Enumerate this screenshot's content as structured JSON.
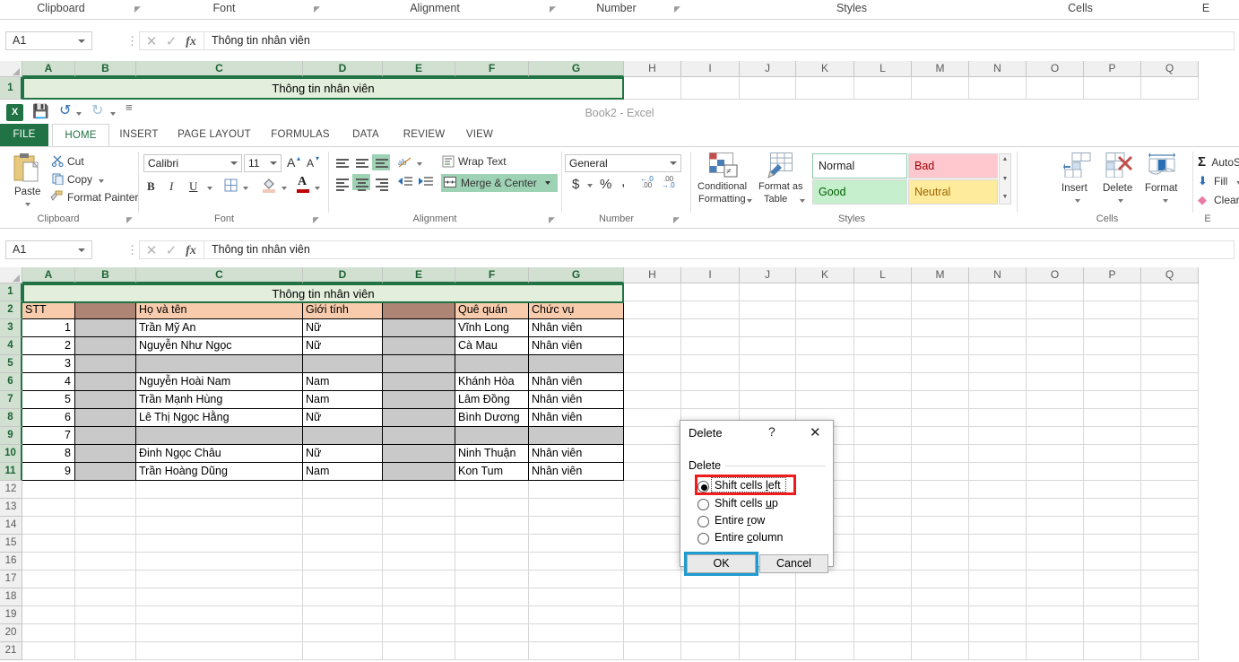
{
  "top_strip": {
    "group_labels": [
      "Clipboard",
      "Font",
      "Alignment",
      "Number",
      "Styles",
      "Cells",
      "E"
    ],
    "name_box": "A1",
    "formula_value": "Thông tin nhân viên",
    "cancel_icon": "cancel-icon",
    "enter_icon": "enter-icon",
    "fx_icon": "fx-icon"
  },
  "window": {
    "title": "Book2 - Excel",
    "logo_text": "X",
    "qat": [
      {
        "name": "save-icon",
        "glyph": "💾"
      },
      {
        "name": "undo-icon",
        "glyph": "↶"
      },
      {
        "name": "redo-icon",
        "glyph": "↷"
      },
      {
        "name": "customize-qat-icon",
        "glyph": "≡"
      }
    ],
    "tabs": [
      {
        "label": "FILE",
        "active": false
      },
      {
        "label": "HOME",
        "active": true
      },
      {
        "label": "INSERT",
        "active": false
      },
      {
        "label": "PAGE LAYOUT",
        "active": false
      },
      {
        "label": "FORMULAS",
        "active": false
      },
      {
        "label": "DATA",
        "active": false
      },
      {
        "label": "REVIEW",
        "active": false
      },
      {
        "label": "VIEW",
        "active": false
      }
    ]
  },
  "ribbon": {
    "clipboard": {
      "group_label": "Clipboard",
      "paste_label": "Paste",
      "cut_label": "Cut",
      "copy_label": "Copy",
      "format_painter_label": "Format Painter"
    },
    "font": {
      "group_label": "Font",
      "font_name": "Calibri",
      "font_size": "11",
      "grow_label": "A",
      "shrink_label": "A",
      "bold_label": "B",
      "italic_label": "I",
      "underline_label": "U"
    },
    "alignment": {
      "group_label": "Alignment",
      "wrap_text_label": "Wrap Text",
      "merge_center_label": "Merge & Center"
    },
    "number": {
      "group_label": "Number",
      "format_value": "General",
      "currency_label": "$",
      "percent_label": "%",
      "comma_label": ",",
      "inc_dec_label": ".00",
      "dec_dec_label": ".00"
    },
    "styles": {
      "group_label": "Styles",
      "conditional_formatting_l1": "Conditional",
      "conditional_formatting_l2": "Formatting",
      "format_as_table_l1": "Format as",
      "format_as_table_l2": "Table",
      "gallery": [
        "Normal",
        "Bad",
        "Good",
        "Neutral"
      ]
    },
    "cells": {
      "group_label": "Cells",
      "insert_label": "Insert",
      "delete_label": "Delete",
      "format_label": "Format"
    },
    "editing": {
      "group_label": "E",
      "autosum_label": "AutoSum",
      "fill_label": "Fill",
      "clear_label": "Clear"
    }
  },
  "sheet": {
    "name_box": "A1",
    "formula_value": "Thông tin nhân viên",
    "columns": [
      "A",
      "B",
      "C",
      "D",
      "E",
      "F",
      "G",
      "H",
      "I",
      "J",
      "K",
      "L",
      "M",
      "N",
      "O",
      "P",
      "Q"
    ],
    "selected_columns": [
      "A",
      "B",
      "C",
      "D",
      "E",
      "F",
      "G"
    ],
    "rows": [
      "1",
      "2",
      "3",
      "4",
      "5",
      "6",
      "7",
      "8",
      "9",
      "10",
      "11",
      "12",
      "13",
      "14",
      "15",
      "16",
      "17",
      "18",
      "19",
      "20",
      "21"
    ],
    "selected_rows": [
      "1",
      "2",
      "3",
      "4",
      "5",
      "6",
      "7",
      "8",
      "9",
      "10",
      "11"
    ],
    "title_cell": "Thông tin nhân viên",
    "headers": [
      "STT",
      "",
      "Họ và tên",
      "Giới tính",
      "",
      "Quê quán",
      "Chức vụ"
    ],
    "data_rows": [
      {
        "stt": "1",
        "b": "",
        "name": "Trần Mỹ An",
        "gender": "Nữ",
        "e": "",
        "hometown": "Vĩnh Long",
        "position": "Nhân viên",
        "blank": false
      },
      {
        "stt": "2",
        "b": "",
        "name": "Nguyễn Như Ngọc",
        "gender": "Nữ",
        "e": "",
        "hometown": "Cà Mau",
        "position": "Nhân viên",
        "blank": false
      },
      {
        "stt": "3",
        "b": "",
        "name": "",
        "gender": "",
        "e": "",
        "hometown": "",
        "position": "",
        "blank": true
      },
      {
        "stt": "4",
        "b": "",
        "name": "Nguyễn Hoài Nam",
        "gender": "Nam",
        "e": "",
        "hometown": "Khánh Hòa",
        "position": "Nhân viên",
        "blank": false
      },
      {
        "stt": "5",
        "b": "",
        "name": "Trần Mạnh Hùng",
        "gender": "Nam",
        "e": "",
        "hometown": "Lâm Đồng",
        "position": "Nhân viên",
        "blank": false
      },
      {
        "stt": "6",
        "b": "",
        "name": "Lê Thị Ngọc Hằng",
        "gender": "Nữ",
        "e": "",
        "hometown": "Bình Dương",
        "position": "Nhân viên",
        "blank": false
      },
      {
        "stt": "7",
        "b": "",
        "name": "",
        "gender": "",
        "e": "",
        "hometown": "",
        "position": "",
        "blank": true
      },
      {
        "stt": "8",
        "b": "",
        "name": "Đinh Ngọc Châu",
        "gender": "Nữ",
        "e": "",
        "hometown": "Ninh Thuận",
        "position": "Nhân viên",
        "blank": false
      },
      {
        "stt": "9",
        "b": "",
        "name": "Trần Hoàng Dũng",
        "gender": "Nam",
        "e": "",
        "hometown": "Kon Tum",
        "position": "Nhân viên",
        "blank": false
      }
    ],
    "colors": {
      "header_fill": "#f8cbad",
      "bcol_header_fill": "#ae8574",
      "gray_fill": "#c9c9c9",
      "title_fill": "#e3efdc",
      "selection_accent": "#217346"
    }
  },
  "dialog": {
    "title": "Delete",
    "help_glyph": "?",
    "close_glyph": "✕",
    "group_label": "Delete",
    "options": [
      {
        "label_pre": "Shift cells ",
        "label_u": "l",
        "label_post": "eft",
        "checked": true,
        "highlight": "red"
      },
      {
        "label_pre": "Shift cells ",
        "label_u": "u",
        "label_post": "p",
        "checked": false,
        "highlight": ""
      },
      {
        "label_pre": "Entire ",
        "label_u": "r",
        "label_post": "ow",
        "checked": false,
        "highlight": ""
      },
      {
        "label_pre": "Entire ",
        "label_u": "c",
        "label_post": "olumn",
        "checked": false,
        "highlight": ""
      }
    ],
    "ok_label": "OK",
    "cancel_label": "Cancel",
    "ok_highlight": "#1f9bd0",
    "selected_highlight": "#f01c1c"
  }
}
